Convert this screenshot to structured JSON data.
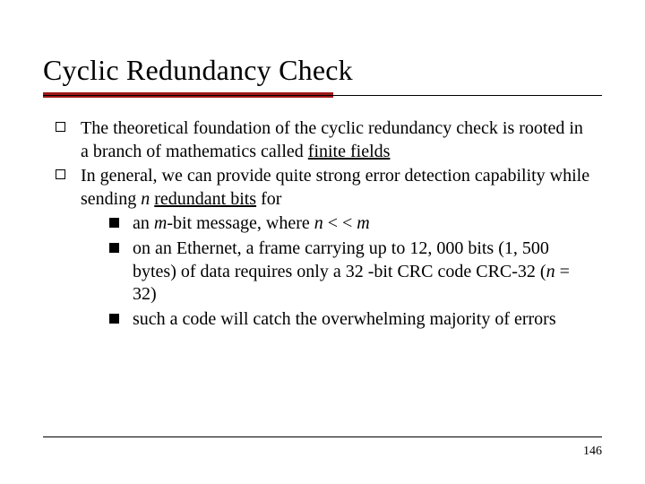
{
  "slide": {
    "title": "Cyclic Redundancy Check",
    "bullets": [
      {
        "pre": "The theoretical foundation of the cyclic redundancy check is rooted in a branch of mathematics called ",
        "underline": "finite fields",
        "post": ""
      },
      {
        "pre": "In general, we can provide quite strong error detection capability while sending ",
        "italic1": "n",
        "mid": " ",
        "underline": "redundant bits",
        "post": " for",
        "sub": [
          {
            "pre": "an ",
            "italic1": "m",
            "mid": "-bit message, where ",
            "italic2": "n",
            "mid2": " < < ",
            "italic3": "m",
            "post": ""
          },
          {
            "pre": "on an Ethernet, a frame carrying up to 12, 000 bits (1, 500 bytes) of data requires only a 32 -bit CRC code CRC-32 (",
            "italic1": "n",
            "mid": " = 32)",
            "post": ""
          },
          {
            "pre": "such a code will catch the overwhelming majority of errors",
            "post": ""
          }
        ]
      }
    ],
    "page_number": "146"
  }
}
